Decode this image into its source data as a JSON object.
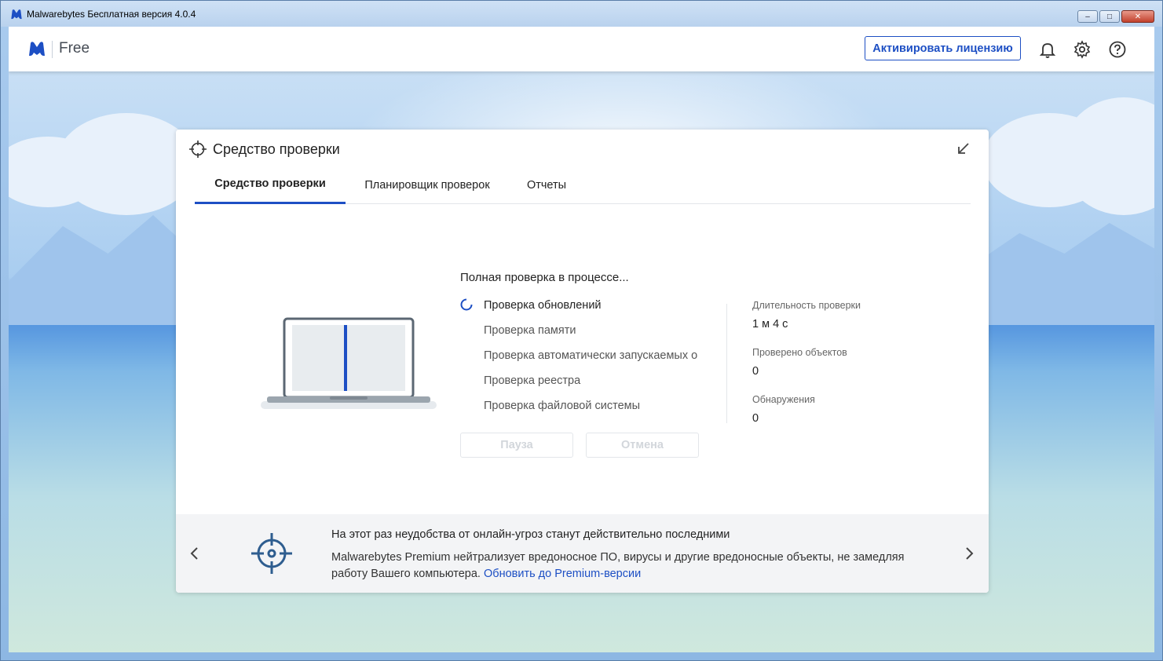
{
  "window": {
    "title": "Malwarebytes Бесплатная версия  4.0.4",
    "controls": {
      "minimize": "–",
      "maximize": "□",
      "close": "✕"
    }
  },
  "header": {
    "brand": "Free",
    "activate_label": "Активировать лицензию",
    "icons": [
      "bell-icon",
      "gear-icon",
      "help-icon"
    ]
  },
  "card": {
    "title": "Средство проверки",
    "tabs": [
      {
        "label": "Средство проверки",
        "active": true
      },
      {
        "label": "Планировщик проверок",
        "active": false
      },
      {
        "label": "Отчеты",
        "active": false
      }
    ],
    "scan": {
      "status": "Полная проверка в процессе...",
      "steps": [
        {
          "label": "Проверка обновлений",
          "state": "current"
        },
        {
          "label": "Проверка памяти",
          "state": "pending"
        },
        {
          "label": "Проверка автоматически запускаемых о",
          "state": "pending"
        },
        {
          "label": "Проверка реестра",
          "state": "pending"
        },
        {
          "label": "Проверка файловой системы",
          "state": "pending"
        }
      ],
      "pause_label": "Пауза",
      "cancel_label": "Отмена"
    },
    "stats": {
      "duration_label": "Длительность проверки",
      "duration_value": "1 м 4 с",
      "scanned_label": "Проверено объектов",
      "scanned_value": "0",
      "detections_label": "Обнаружения",
      "detections_value": "0"
    },
    "promo": {
      "headline": "На этот раз неудобства от онлайн-угроз станут действительно последними",
      "body": "Malwarebytes Premium нейтрализует вредоносное ПО, вирусы и другие вредоносные объекты, не замедляя работу Вашего компьютера.",
      "link": "Обновить до Premium-версии"
    }
  },
  "colors": {
    "accent": "#1d4fc4",
    "text": "#222222",
    "muted": "#666666",
    "disabled": "#d2d6db"
  }
}
